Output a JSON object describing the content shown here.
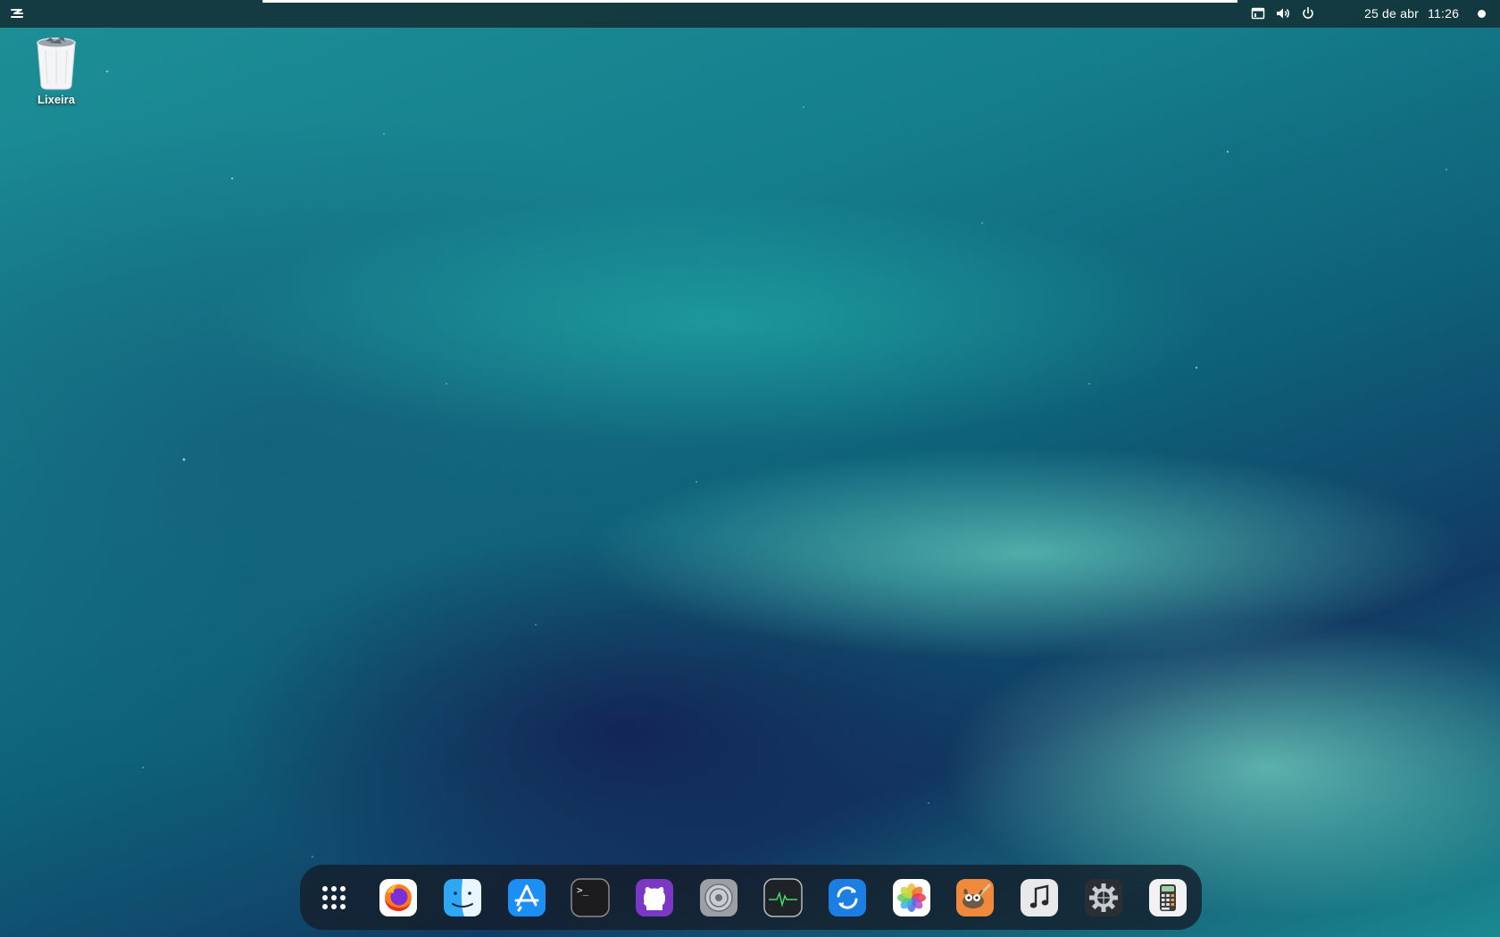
{
  "topbar": {
    "clock_date": "25 de abr",
    "clock_time": "11:26",
    "tray_icons": [
      "window-icon",
      "volume-icon",
      "power-icon"
    ]
  },
  "desktop": {
    "items": [
      {
        "label": "Lixeira",
        "icon": "trash-icon"
      }
    ]
  },
  "dock": {
    "items": [
      {
        "name": "show-apps",
        "icon": "app-grid-icon"
      },
      {
        "name": "firefox",
        "icon": "firefox-icon"
      },
      {
        "name": "finder",
        "icon": "finder-icon"
      },
      {
        "name": "app-store",
        "icon": "app-store-icon"
      },
      {
        "name": "terminal",
        "icon": "terminal-icon"
      },
      {
        "name": "github-desktop",
        "icon": "github-icon"
      },
      {
        "name": "disks",
        "icon": "disk-icon"
      },
      {
        "name": "system-monitor",
        "icon": "activity-monitor-icon"
      },
      {
        "name": "software-update",
        "icon": "update-icon"
      },
      {
        "name": "photos",
        "icon": "photos-icon"
      },
      {
        "name": "gimp",
        "icon": "gimp-icon"
      },
      {
        "name": "music",
        "icon": "music-icon"
      },
      {
        "name": "settings",
        "icon": "settings-gear-icon"
      },
      {
        "name": "calculator",
        "icon": "calculator-icon"
      }
    ],
    "terminal_prompt": ">_"
  },
  "colors": {
    "topbar_bg": "#14343a",
    "dock_bg": "#141c28",
    "wallpaper_aurora": "#7ff5d5",
    "wallpaper_sky": "#0e6079"
  }
}
